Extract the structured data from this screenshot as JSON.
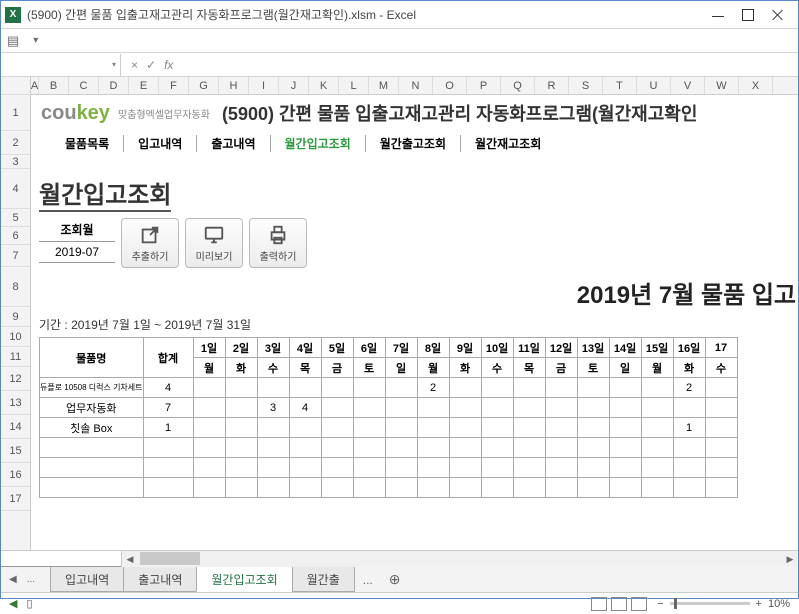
{
  "window": {
    "title": "(5900) 간편 물품 입출고재고관리 자동화프로그램(월간재고확인).xlsm - Excel",
    "app_abbrev": "X"
  },
  "formula_bar": {
    "fx": "fx"
  },
  "col_headers": [
    "A",
    "B",
    "C",
    "D",
    "E",
    "F",
    "G",
    "H",
    "I",
    "J",
    "K",
    "L",
    "M",
    "N",
    "O",
    "P",
    "Q",
    "R",
    "S",
    "T",
    "U",
    "V",
    "W",
    "X"
  ],
  "row_headers": [
    "1",
    "2",
    "3",
    "4",
    "5",
    "6",
    "7",
    "8",
    "9",
    "10",
    "11",
    "12",
    "13",
    "14",
    "15",
    "16",
    "17"
  ],
  "brand": {
    "name_pre": "cou",
    "name_key": "key",
    "tagline": "맞춤형엑셀업무자동화",
    "headline": "(5900) 간편 물품 입출고재고관리 자동화프로그램(월간재고확인"
  },
  "nav": {
    "items": [
      "물품목록",
      "입고내역",
      "출고내역",
      "월간입고조회",
      "월간출고조회",
      "월간재고조회"
    ],
    "active_index": 3
  },
  "page": {
    "title": "월간입고조회",
    "query_label": "조회월",
    "query_value": "2019-07",
    "buttons": {
      "extract": "추출하기",
      "preview": "미리보기",
      "print": "출력하기"
    },
    "big_title": "2019년 7월 물품 입고",
    "period": "기간 : 2019년 7월 1일 ~ 2019년 7월 31일"
  },
  "table": {
    "name_header": "물품명",
    "sum_header": "합계",
    "days": [
      "1일",
      "2일",
      "3일",
      "4일",
      "5일",
      "6일",
      "7일",
      "8일",
      "9일",
      "10일",
      "11일",
      "12일",
      "13일",
      "14일",
      "15일",
      "16일",
      "17"
    ],
    "weekdays": [
      "월",
      "화",
      "수",
      "목",
      "금",
      "토",
      "일",
      "월",
      "화",
      "수",
      "목",
      "금",
      "토",
      "일",
      "월",
      "화",
      "수"
    ],
    "rows": [
      {
        "name": "듀플로 10508 디럭스 기차세트",
        "sum": "4",
        "cells": [
          "",
          "",
          "",
          "",
          "",
          "",
          "",
          "2",
          "",
          "",
          "",
          "",
          "",
          "",
          "",
          "2",
          ""
        ]
      },
      {
        "name": "업무자동화",
        "sum": "7",
        "cells": [
          "",
          "",
          "3",
          "4",
          "",
          "",
          "",
          "",
          "",
          "",
          "",
          "",
          "",
          "",
          "",
          "",
          ""
        ]
      },
      {
        "name": "칫솔 Box",
        "sum": "1",
        "cells": [
          "",
          "",
          "",
          "",
          "",
          "",
          "",
          "",
          "",
          "",
          "",
          "",
          "",
          "",
          "",
          "1",
          ""
        ]
      }
    ]
  },
  "sheets": {
    "tabs": [
      "입고내역",
      "출고내역",
      "월간입고조회",
      "월간출"
    ],
    "active_index": 2,
    "ellipsis": "..."
  },
  "statusbar": {
    "zoom": "10%"
  }
}
